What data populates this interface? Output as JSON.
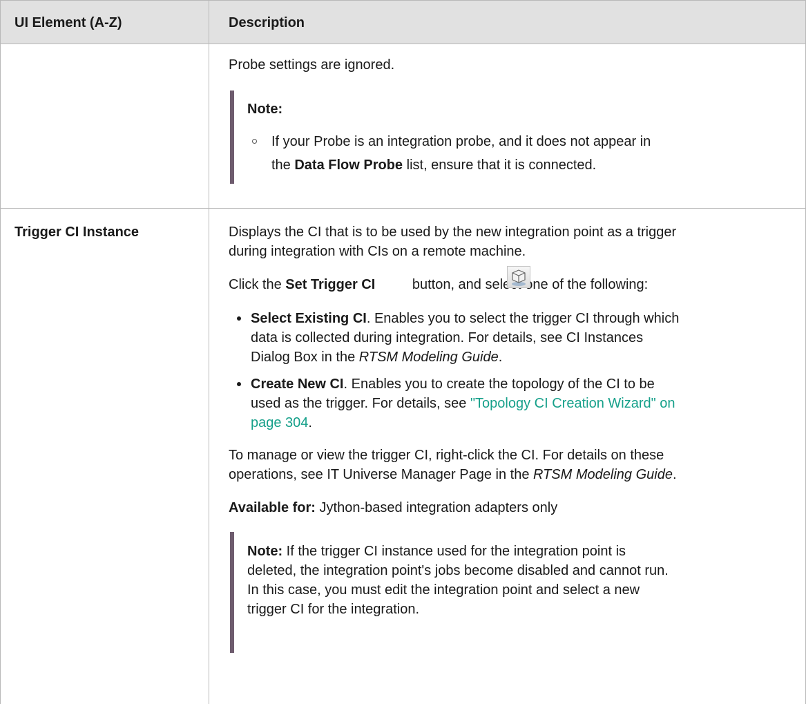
{
  "header": {
    "col1": "UI Element (A-Z)",
    "col2": "Description"
  },
  "row1": {
    "line1": "Probe settings are ignored.",
    "note_label": "Note:",
    "note_l1": "If your Probe is an integration probe, and it does not appear in",
    "note_l2_pre": "the ",
    "note_l2_bold": "Data Flow Probe",
    "note_l2_post": " list, ensure that it is connected."
  },
  "row2": {
    "element": "Trigger CI Instance",
    "p1_l1": "Displays the CI that is to be used by the new integration point as a trigger",
    "p1_l2": "during integration with CIs on a remote machine.",
    "p2_pre": "Click the ",
    "p2_bold": "Set Trigger CI",
    "p2_post": " button, and select one of the following:",
    "b1_bold": "Select Existing CI",
    "b1_l1": ". Enables you to select the trigger CI through which",
    "b1_l2": "data is collected during integration. For details, see CI Instances",
    "b1_l3_pre": "Dialog Box in the ",
    "b1_l3_italic": "RTSM Modeling Guide",
    "b1_l3_post": ".",
    "b2_bold": "Create New CI",
    "b2_l1": ". Enables you to create the topology of the CI to be",
    "b2_l2_pre": "used as the trigger. For details, see ",
    "b2_l2_link": "\"Topology CI Creation Wizard\" on",
    "b2_l3_link": "page 304",
    "b2_l3_post": ".",
    "p3_l1": "To manage or view the trigger CI, right-click the CI. For details on these",
    "p3_l2_pre": "operations, see IT Universe Manager Page in the ",
    "p3_l2_italic": "RTSM Modeling Guide",
    "p3_l2_post": ".",
    "avail_bold": "Available for:",
    "avail_text": " Jython-based integration adapters only",
    "note_bold": "Note:",
    "note_l1": "  If the trigger CI instance used for the integration point is",
    "note_l2": "deleted, the integration point's jobs become disabled and cannot run.",
    "note_l3": "In this case, you must edit the integration point and select a new",
    "note_l4": "trigger CI for the integration."
  },
  "icons": {
    "trigger": "set-trigger-ci-icon"
  }
}
